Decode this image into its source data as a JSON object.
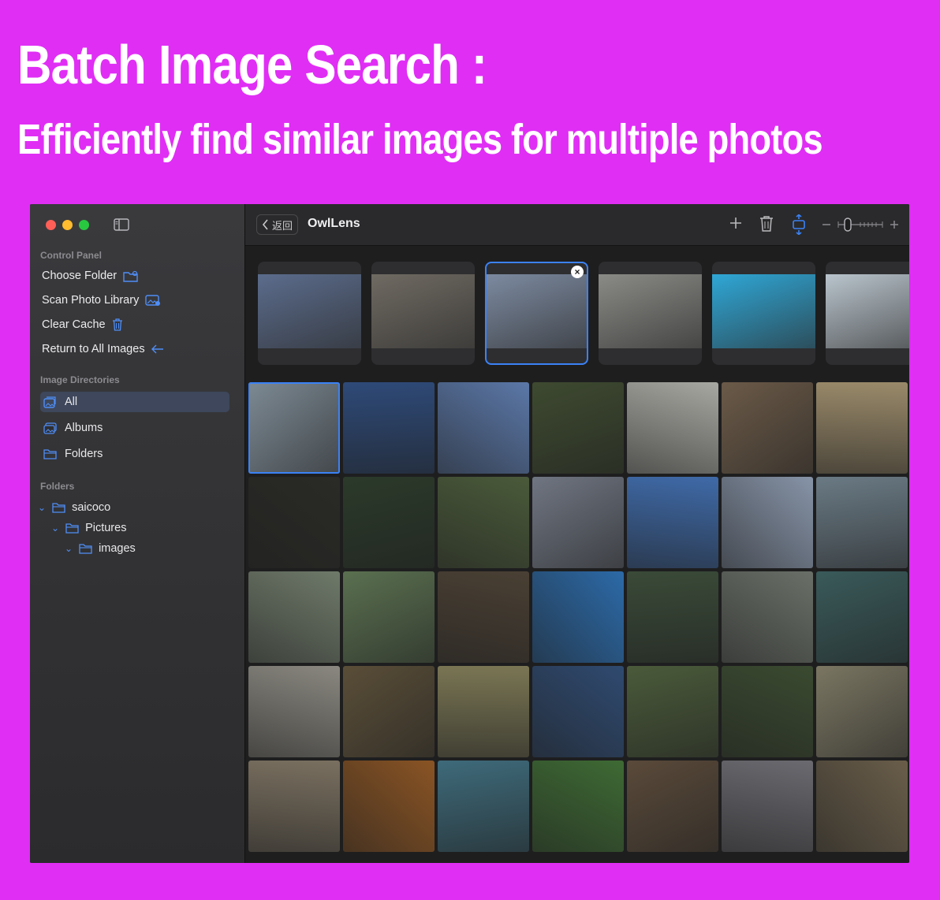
{
  "hero": {
    "title": "Batch Image Search :",
    "subtitle": "Efficiently find similar images for multiple photos"
  },
  "colors": {
    "background": "#e02ef5",
    "accent": "#3b82f6",
    "sidebar": "#333336",
    "main": "#1e1e1f"
  },
  "sidebar": {
    "control_panel_title": "Control Panel",
    "control_items": [
      {
        "label": "Choose Folder",
        "icon": "folder-badge-icon"
      },
      {
        "label": "Scan Photo Library",
        "icon": "photo-badge-icon"
      },
      {
        "label": "Clear Cache",
        "icon": "trash-icon"
      },
      {
        "label": "Return to All Images",
        "icon": "arrow-left-icon"
      }
    ],
    "directories_title": "Image Directories",
    "directories": [
      {
        "label": "All",
        "icon": "photo-stack-icon",
        "active": true
      },
      {
        "label": "Albums",
        "icon": "album-icon",
        "active": false
      },
      {
        "label": "Folders",
        "icon": "folder-icon",
        "active": false
      }
    ],
    "folders_title": "Folders",
    "folder_tree": [
      {
        "label": "saicoco",
        "level": 0
      },
      {
        "label": "Pictures",
        "level": 1
      },
      {
        "label": "images",
        "level": 2
      }
    ]
  },
  "toolbar": {
    "back_label": "返回",
    "app_title": "OwlLens",
    "icons": [
      "plus-icon",
      "trash-icon",
      "fit-height-icon",
      "minus-icon",
      "zoom-slider",
      "plus-icon"
    ]
  },
  "selected_strip": {
    "active_index": 2,
    "items": [
      "#5b6c8c",
      "#6f6a62",
      "#7c8aa0",
      "#8a8a86",
      "#2fa7d6",
      "#b9c4cc"
    ]
  },
  "grid": {
    "active_index": 0,
    "rows": [
      [
        "#7d8a94",
        "#2e4a78",
        "#5b78a8",
        "#3e4a30",
        "#a8a8a2",
        "#6b5a48",
        "#9a8a6a"
      ],
      [
        "#2a2a26",
        "#2b3a2a",
        "#4a5a3a",
        "#707682",
        "#3f6aa8",
        "#8794a8",
        "#6a7a84"
      ],
      [
        "#6f7a6a",
        "#5a7050",
        "#4a4034",
        "#2c6aa8",
        "#3a4a38",
        "#6a7068",
        "#3a5a5a"
      ],
      [
        "#8a8880",
        "#5a4e38",
        "#7a7654",
        "#2f4a70",
        "#4a5a3a",
        "#3a4a30",
        "#7a7662"
      ],
      [
        "#7a7060",
        "#8a5424",
        "#3e6a7a",
        "#3e6a34",
        "#5a4a3a",
        "#6a6a70",
        "#6a5e4a"
      ]
    ]
  }
}
